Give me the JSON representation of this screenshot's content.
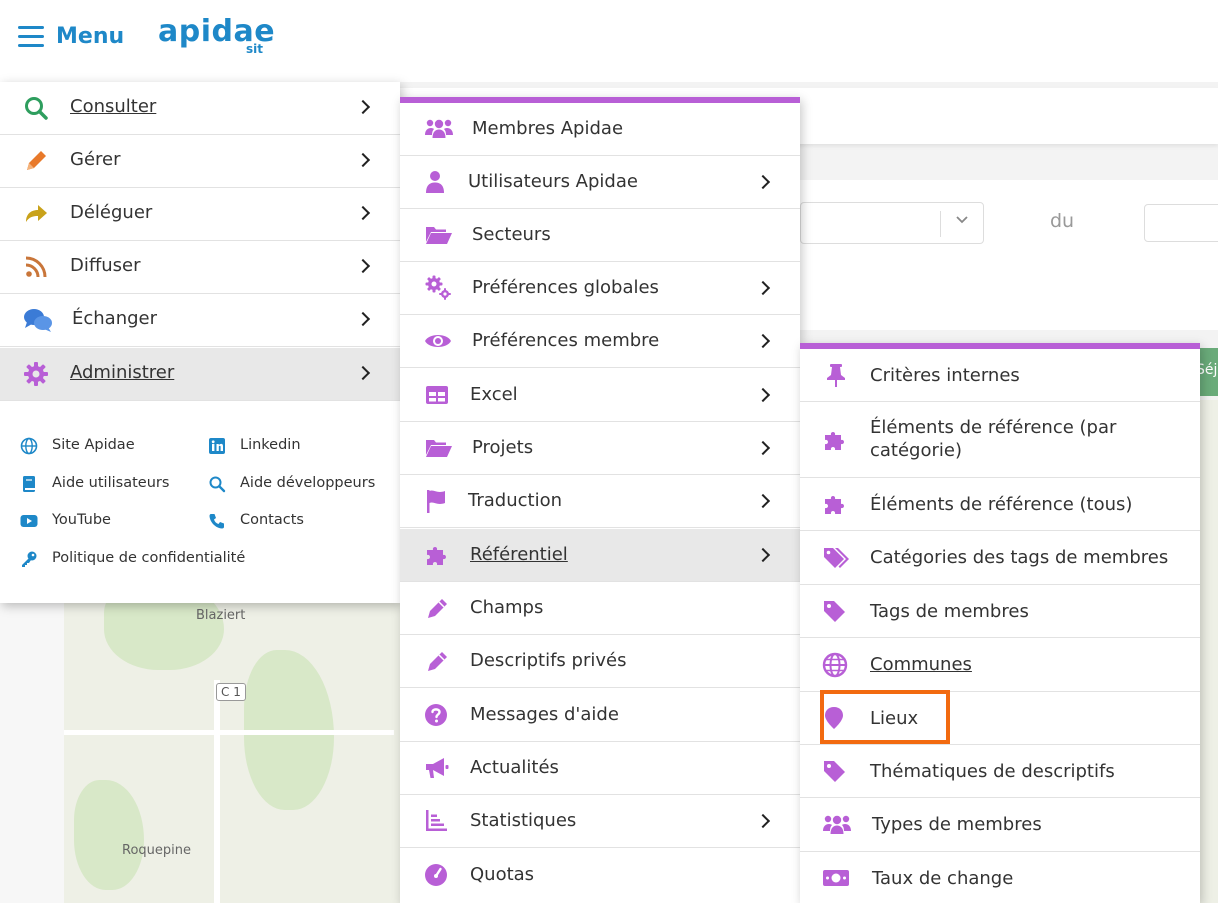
{
  "header": {
    "menu_label": "Menu",
    "logo": "apidae",
    "logo_sub": "sit"
  },
  "background": {
    "du_label": "du",
    "map_labels": [
      "Blaziert",
      "C 1",
      "Roquepine"
    ],
    "tab_text": "Séjo"
  },
  "main_menu": {
    "items": [
      {
        "label": "Consulter",
        "icon": "search-icon",
        "color": "#2e9e5e"
      },
      {
        "label": "Gérer",
        "icon": "pencil-icon",
        "color": "#e8792a"
      },
      {
        "label": "Déléguer",
        "icon": "share-arrow-icon",
        "color": "#c9a21a"
      },
      {
        "label": "Diffuser",
        "icon": "rss-icon",
        "color": "#c9763a"
      },
      {
        "label": "Échanger",
        "icon": "chat-bubbles-icon",
        "color": "#3b7bd6"
      },
      {
        "label": "Administrer",
        "icon": "gear-icon",
        "color": "#b85fd6"
      }
    ],
    "footer_links": [
      {
        "label": "Site Apidae",
        "icon": "globe-icon"
      },
      {
        "label": "Linkedin",
        "icon": "linkedin-icon"
      },
      {
        "label": "Aide utilisateurs",
        "icon": "book-icon"
      },
      {
        "label": "Aide développeurs",
        "icon": "search-icon"
      },
      {
        "label": "YouTube",
        "icon": "youtube-icon"
      },
      {
        "label": "Contacts",
        "icon": "phone-icon"
      },
      {
        "label": "Politique de confidentialité",
        "icon": "key-icon"
      }
    ]
  },
  "admin_menu": {
    "items": [
      {
        "label": "Membres Apidae",
        "icon": "users-icon"
      },
      {
        "label": "Utilisateurs Apidae",
        "icon": "user-icon"
      },
      {
        "label": "Secteurs",
        "icon": "folder-open-icon"
      },
      {
        "label": "Préférences globales",
        "icon": "gears-icon"
      },
      {
        "label": "Préférences membre",
        "icon": "eye-icon"
      },
      {
        "label": "Excel",
        "icon": "table-icon"
      },
      {
        "label": "Projets",
        "icon": "folder-open-icon"
      },
      {
        "label": "Traduction",
        "icon": "flag-icon"
      },
      {
        "label": "Référentiel",
        "icon": "puzzle-icon"
      },
      {
        "label": "Champs",
        "icon": "pencil-icon"
      },
      {
        "label": "Descriptifs privés",
        "icon": "pencil-icon"
      },
      {
        "label": "Messages d'aide",
        "icon": "question-circle-icon"
      },
      {
        "label": "Actualités",
        "icon": "megaphone-icon"
      },
      {
        "label": "Statistiques",
        "icon": "bar-chart-icon"
      },
      {
        "label": "Quotas",
        "icon": "gauge-icon"
      }
    ]
  },
  "referentiel_menu": {
    "items": [
      {
        "label": "Critères internes",
        "icon": "thumbtack-icon"
      },
      {
        "label": "Éléments de référence (par catégorie)",
        "icon": "puzzle-icon"
      },
      {
        "label": "Éléments de référence (tous)",
        "icon": "puzzle-icon"
      },
      {
        "label": "Catégories des tags de membres",
        "icon": "tags-icon"
      },
      {
        "label": "Tags de membres",
        "icon": "tag-icon"
      },
      {
        "label": "Communes",
        "icon": "globe-icon"
      },
      {
        "label": "Lieux",
        "icon": "map-marker-icon"
      },
      {
        "label": "Thématiques de descriptifs",
        "icon": "tag-icon"
      },
      {
        "label": "Types de membres",
        "icon": "users-icon"
      },
      {
        "label": "Taux de change",
        "icon": "money-bill-icon"
      }
    ]
  },
  "colors": {
    "brand_blue": "#1e88c8",
    "admin_purple": "#b85fd6",
    "highlight_orange": "#f26a10"
  }
}
